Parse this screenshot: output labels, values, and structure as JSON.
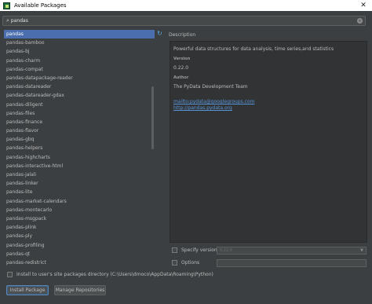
{
  "window": {
    "title": "Available Packages"
  },
  "search": {
    "value": "pandas"
  },
  "packages": {
    "items": [
      "pandas",
      "pandas-bamboo",
      "pandas-bj",
      "pandas-charm",
      "pandas-compat",
      "pandas-datapackage-reader",
      "pandas-datareader",
      "pandas-datareader-gdax",
      "pandas-diligent",
      "pandas-files",
      "pandas-finance",
      "pandas-flavor",
      "pandas-gbq",
      "pandas-helpers",
      "pandas-highcharts",
      "pandas-interactive-html",
      "pandas-jalali",
      "pandas-linker",
      "pandas-lite",
      "pandas-market-calendars",
      "pandas-montecarlo",
      "pandas-msgpack",
      "pandas-plink",
      "pandas-ply",
      "pandas-profiling",
      "pandas-qt",
      "pandas-redistrict"
    ],
    "selected_index": 0
  },
  "description": {
    "header": "Description",
    "summary": "Powerful data structures for data analysis, time series,and statistics",
    "version_label": "Version",
    "version": "0.22.0",
    "author_label": "Author",
    "author": "The PyData Development Team",
    "email_link": "mailto:pydata@googlegroups.com",
    "url_link": "http://pandas.pydata.org"
  },
  "options": {
    "specify_version_label": "Specify version",
    "specify_version_value": "0.22.0",
    "options_label": "Options",
    "options_value": ""
  },
  "install_to_user": {
    "label": "Install to user's site packages directory (C:\\Users\\dmoco\\AppData\\Roaming\\Python)"
  },
  "buttons": {
    "install": "Install Package",
    "manage": "Manage Repositories"
  },
  "icons": {
    "search": "search-icon",
    "clear": "clear-search-icon",
    "refresh": "refresh-icon",
    "close": "close-icon"
  }
}
